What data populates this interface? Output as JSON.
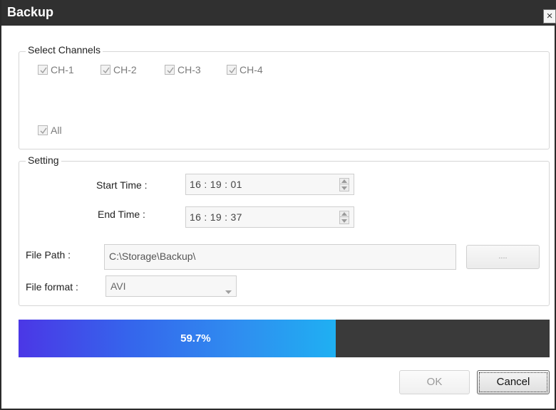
{
  "window": {
    "title": "Backup",
    "close_glyph": "×"
  },
  "select_channels": {
    "legend": "Select Channels",
    "channels": [
      {
        "label": "CH-1",
        "checked": true
      },
      {
        "label": "CH-2",
        "checked": true
      },
      {
        "label": "CH-3",
        "checked": true
      },
      {
        "label": "CH-4",
        "checked": true
      }
    ],
    "all": {
      "label": "All",
      "checked": true
    }
  },
  "setting": {
    "legend": "Setting",
    "start_time_label": "Start Time :",
    "start_time_value": "16 : 19 : 01",
    "end_time_label": "End Time :",
    "end_time_value": "16 : 19 : 37",
    "file_path_label": "File Path :",
    "file_path_value": "C:\\Storage\\Backup\\",
    "browse_label": "....",
    "file_format_label": "File format :",
    "file_format_value": "AVI"
  },
  "progress": {
    "value": 0.597,
    "label": "59.7%"
  },
  "buttons": {
    "ok": "OK",
    "cancel": "Cancel"
  },
  "colors": {
    "titlebar": "#303030",
    "progress_track": "#3a3a3a",
    "progress_start": "#4b37e6",
    "progress_end": "#1fb0f2"
  },
  "icons": {
    "close": "close-icon",
    "checkbox": "checkmark-icon",
    "spin_up": "chevron-up-icon",
    "spin_down": "chevron-down-icon",
    "dropdown": "chevron-down-icon"
  }
}
